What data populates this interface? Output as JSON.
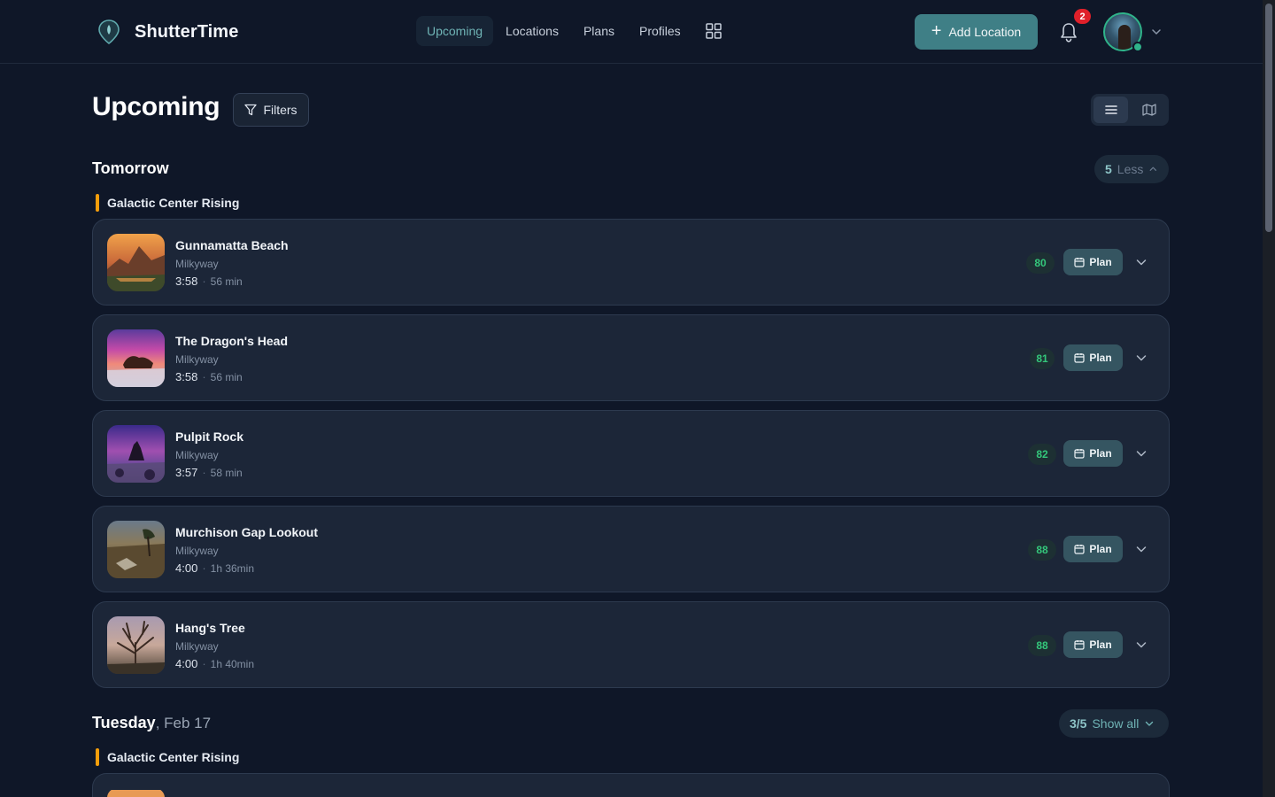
{
  "header": {
    "brand": "ShutterTime",
    "nav": [
      {
        "label": "Upcoming",
        "active": true
      },
      {
        "label": "Locations",
        "active": false
      },
      {
        "label": "Plans",
        "active": false
      },
      {
        "label": "Profiles",
        "active": false
      }
    ],
    "add_location_label": "Add Location",
    "notification_count": "2",
    "icons": [
      "map-pin-logo-icon",
      "grid-icon",
      "plus-icon",
      "bell-icon",
      "avatar",
      "chevron-down-icon"
    ]
  },
  "page": {
    "title": "Upcoming",
    "filters_label": "Filters",
    "view_modes": [
      "list",
      "map"
    ],
    "active_view": "list"
  },
  "sections": [
    {
      "day": "Tomorrow",
      "date": "",
      "toggle_count": "5",
      "toggle_label": "Less",
      "event": "Galactic Center Rising",
      "items": [
        {
          "name": "Gunnamatta Beach",
          "type": "Milkyway",
          "time": "3:58",
          "duration": "56 min",
          "score": "80",
          "plan_label": "Plan"
        },
        {
          "name": "The Dragon's Head",
          "type": "Milkyway",
          "time": "3:58",
          "duration": "56 min",
          "score": "81",
          "plan_label": "Plan"
        },
        {
          "name": "Pulpit Rock",
          "type": "Milkyway",
          "time": "3:57",
          "duration": "58 min",
          "score": "82",
          "plan_label": "Plan"
        },
        {
          "name": "Murchison Gap Lookout",
          "type": "Milkyway",
          "time": "4:00",
          "duration": "1h 36min",
          "score": "88",
          "plan_label": "Plan"
        },
        {
          "name": "Hang's Tree",
          "type": "Milkyway",
          "time": "4:00",
          "duration": "1h 40min",
          "score": "88",
          "plan_label": "Plan"
        }
      ]
    },
    {
      "day": "Tuesday",
      "date": ", Feb 17",
      "toggle_count": "3/5",
      "toggle_label": "Show all",
      "event": "Galactic Center Rising"
    }
  ],
  "colors": {
    "background": "#0f1728",
    "card": "#1c2638",
    "accent": "#3f7f86",
    "score_green": "#34c77b",
    "event_marker": "#f59e0b",
    "badge_red": "#e0202a"
  }
}
